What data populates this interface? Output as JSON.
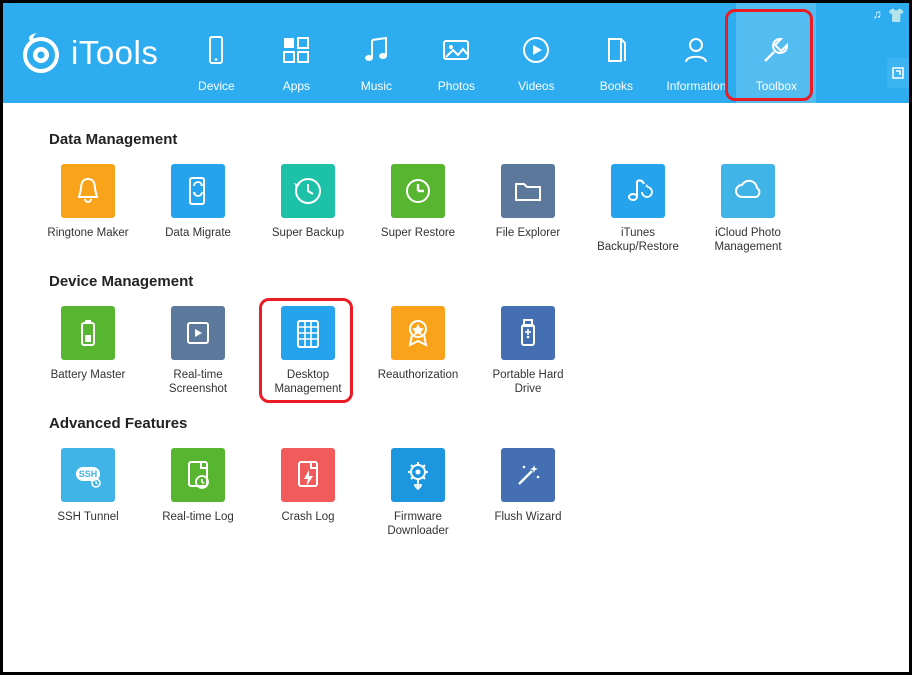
{
  "app_name": "iTools",
  "header_nav": [
    {
      "id": "device",
      "label": "Device",
      "icon": "device-icon"
    },
    {
      "id": "apps",
      "label": "Apps",
      "icon": "apps-icon"
    },
    {
      "id": "music",
      "label": "Music",
      "icon": "music-icon"
    },
    {
      "id": "photos",
      "label": "Photos",
      "icon": "photos-icon"
    },
    {
      "id": "videos",
      "label": "Videos",
      "icon": "videos-icon"
    },
    {
      "id": "books",
      "label": "Books",
      "icon": "books-icon"
    },
    {
      "id": "information",
      "label": "Information",
      "icon": "information-icon"
    },
    {
      "id": "toolbox",
      "label": "Toolbox",
      "icon": "toolbox-icon",
      "active": true,
      "highlighted": true
    }
  ],
  "sections": [
    {
      "title": "Data Management",
      "tiles": [
        {
          "id": "ringtone",
          "label": "Ringtone Maker",
          "color": "c-orange",
          "icon": "bell-icon"
        },
        {
          "id": "migrate",
          "label": "Data Migrate",
          "color": "c-blue",
          "icon": "phone-sync-icon"
        },
        {
          "id": "backup",
          "label": "Super Backup",
          "color": "c-teal",
          "icon": "clock-back-icon"
        },
        {
          "id": "restore",
          "label": "Super Restore",
          "color": "c-green",
          "icon": "clock-fwd-icon"
        },
        {
          "id": "explorer",
          "label": "File Explorer",
          "color": "c-bluegray",
          "icon": "folder-icon"
        },
        {
          "id": "itunes",
          "label": "iTunes Backup/Restore",
          "color": "c-blue",
          "icon": "note-sync-icon"
        },
        {
          "id": "icloud",
          "label": "iCloud Photo Management",
          "color": "c-ltblue",
          "icon": "cloud-icon"
        }
      ]
    },
    {
      "title": "Device Management",
      "tiles": [
        {
          "id": "battery",
          "label": "Battery Master",
          "color": "c-green",
          "icon": "battery-icon"
        },
        {
          "id": "screenshot",
          "label": "Real-time Screenshot",
          "color": "c-bluegray",
          "icon": "screenshot-icon"
        },
        {
          "id": "desktop",
          "label": "Desktop Management",
          "color": "c-blue",
          "icon": "desktop-icon",
          "highlighted": true
        },
        {
          "id": "reauth",
          "label": "Reauthorization",
          "color": "c-orange",
          "icon": "badge-icon"
        },
        {
          "id": "portable",
          "label": "Portable Hard Drive",
          "color": "c-navy",
          "icon": "usb-icon"
        }
      ]
    },
    {
      "title": "Advanced Features",
      "tiles": [
        {
          "id": "ssh",
          "label": "SSH Tunnel",
          "color": "c-ltblue",
          "icon": "ssh-icon"
        },
        {
          "id": "rtlog",
          "label": "Real-time Log",
          "color": "c-green",
          "icon": "page-clock-icon"
        },
        {
          "id": "crash",
          "label": "Crash Log",
          "color": "c-red",
          "icon": "page-bolt-icon"
        },
        {
          "id": "firmware",
          "label": "Firmware Downloader",
          "color": "c-blue2",
          "icon": "gear-down-icon"
        },
        {
          "id": "flush",
          "label": "Flush Wizard",
          "color": "c-navy",
          "icon": "wand-icon"
        }
      ]
    }
  ]
}
